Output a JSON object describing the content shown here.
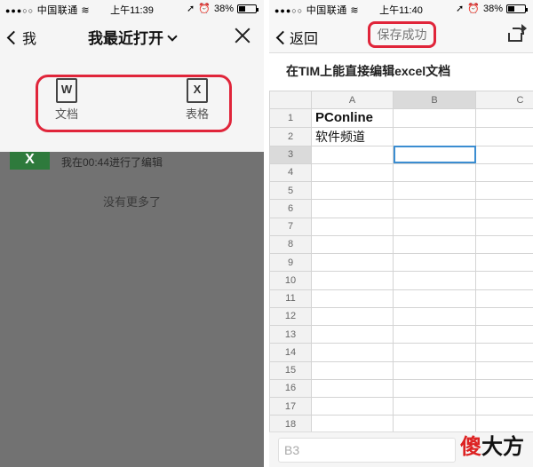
{
  "left": {
    "status": {
      "carrier": "中国联通",
      "time": "上午11:39",
      "battery": "38%"
    },
    "nav": {
      "back_label": "我",
      "title": "我最近打开"
    },
    "picker": {
      "options": [
        {
          "label": "文档",
          "glyph": "W",
          "icon": "word-doc-icon"
        },
        {
          "label": "表格",
          "glyph": "X",
          "icon": "sheet-doc-icon"
        }
      ]
    },
    "recent": {
      "item_text": "我在00:44进行了编辑",
      "thumb_glyph": "X",
      "empty_text": "没有更多了"
    }
  },
  "right": {
    "status": {
      "carrier": "中国联通",
      "time": "上午11:40",
      "battery": "38%"
    },
    "nav": {
      "back_label": "返回",
      "save_status": "保存成功"
    },
    "doc_title": "在TIM上能直接编辑excel文档",
    "sheet": {
      "columns": [
        "A",
        "B",
        "C"
      ],
      "rows": [
        {
          "n": "1",
          "a": "PConline"
        },
        {
          "n": "2",
          "a": "软件频道"
        },
        {
          "n": "3",
          "a": ""
        },
        {
          "n": "4",
          "a": ""
        },
        {
          "n": "5",
          "a": ""
        },
        {
          "n": "6",
          "a": ""
        },
        {
          "n": "7",
          "a": ""
        },
        {
          "n": "8",
          "a": ""
        },
        {
          "n": "9",
          "a": ""
        },
        {
          "n": "10",
          "a": ""
        },
        {
          "n": "11",
          "a": ""
        },
        {
          "n": "12",
          "a": ""
        },
        {
          "n": "13",
          "a": ""
        },
        {
          "n": "14",
          "a": ""
        },
        {
          "n": "15",
          "a": ""
        },
        {
          "n": "16",
          "a": ""
        },
        {
          "n": "17",
          "a": ""
        },
        {
          "n": "18",
          "a": ""
        }
      ],
      "selected_cell": "B3"
    },
    "formula_bar": {
      "cell_ref": "B3"
    },
    "watermark": {
      "text_red": "傻",
      "text": "大方"
    }
  },
  "colors": {
    "highlight": "#e0253a",
    "selection": "#3b8dd1",
    "excel_green": "#2e7a3c"
  }
}
